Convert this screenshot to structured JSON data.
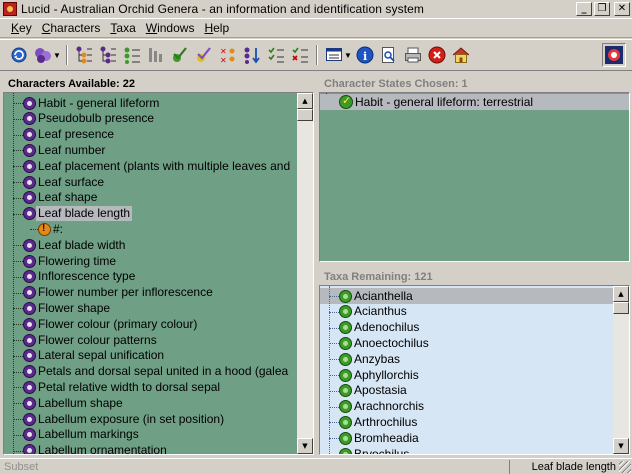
{
  "window": {
    "title": "Lucid - Australian Orchid Genera - an information and identification system",
    "min_glyph": "_",
    "restore_glyph": "❐",
    "close_glyph": "✕"
  },
  "menu": [
    {
      "pre": "",
      "ul": "K",
      "post": "ey"
    },
    {
      "pre": "",
      "ul": "C",
      "post": "haracters"
    },
    {
      "pre": "",
      "ul": "T",
      "post": "axa"
    },
    {
      "pre": "",
      "ul": "W",
      "post": "indows"
    },
    {
      "pre": "",
      "ul": "H",
      "post": "elp"
    }
  ],
  "toolbar": {
    "icons": [
      "refresh-icon",
      "key-options-icon",
      "characters-tree-icon",
      "taxa-tree-icon",
      "sort-list-icon",
      "character-tool-icon",
      "best-character-icon",
      "check-character-icon",
      "sort-taxa-icon",
      "sort-characters-icon",
      "checklist-icon",
      "checklist-x-icon",
      "window-layout-icon",
      "info-icon",
      "search-document-icon",
      "print-icon",
      "stop-icon",
      "home-icon",
      "lucid-logo-icon"
    ]
  },
  "characters_panel": {
    "header": "Characters Available:  22",
    "items": [
      {
        "label": "Habit - general lifeform",
        "kind": "char"
      },
      {
        "label": "Pseudobulb presence",
        "kind": "char"
      },
      {
        "label": "Leaf presence",
        "kind": "char"
      },
      {
        "label": "Leaf number",
        "kind": "char"
      },
      {
        "label": "Leaf placement (plants with multiple leaves and",
        "kind": "char"
      },
      {
        "label": "Leaf surface",
        "kind": "char"
      },
      {
        "label": "Leaf shape",
        "kind": "char"
      },
      {
        "label": "Leaf blade length",
        "kind": "char",
        "selected": true
      },
      {
        "label": "#:",
        "kind": "state"
      },
      {
        "label": "Leaf blade width",
        "kind": "char"
      },
      {
        "label": "Flowering time",
        "kind": "char"
      },
      {
        "label": "Inflorescence type",
        "kind": "char"
      },
      {
        "label": "Flower number per inflorescence",
        "kind": "char"
      },
      {
        "label": "Flower shape",
        "kind": "char"
      },
      {
        "label": "Flower colour (primary colour)",
        "kind": "char"
      },
      {
        "label": "Flower colour patterns",
        "kind": "char"
      },
      {
        "label": "Lateral sepal unification",
        "kind": "char"
      },
      {
        "label": "Petals and dorsal sepal united in a hood (galea",
        "kind": "char"
      },
      {
        "label": "Petal relative width to dorsal sepal",
        "kind": "char"
      },
      {
        "label": "Labellum shape",
        "kind": "char"
      },
      {
        "label": "Labellum exposure (in set position)",
        "kind": "char"
      },
      {
        "label": "Labellum markings",
        "kind": "char"
      },
      {
        "label": "Labellum ornamentation",
        "kind": "char"
      }
    ]
  },
  "states_panel": {
    "header": "Character States Chosen:  1",
    "items": [
      {
        "label": "Habit - general lifeform: terrestrial"
      }
    ]
  },
  "taxa_panel": {
    "header": "Taxa Remaining:  121",
    "items": [
      "Acianthella",
      "Acianthus",
      "Adenochilus",
      "Anoectochilus",
      "Anzybas",
      "Aphyllorchis",
      "Apostasia",
      "Arachnorchis",
      "Arthrochilus",
      "Bromheadia",
      "Bryochilus"
    ]
  },
  "status": {
    "left": "Subset",
    "right": "Leaf blade length"
  },
  "colors": {
    "chrome": "#d4d0c8",
    "characters_bg": "#6f9f85",
    "taxa_bg": "#d6e6f5",
    "selection": "#b6b9bd"
  }
}
